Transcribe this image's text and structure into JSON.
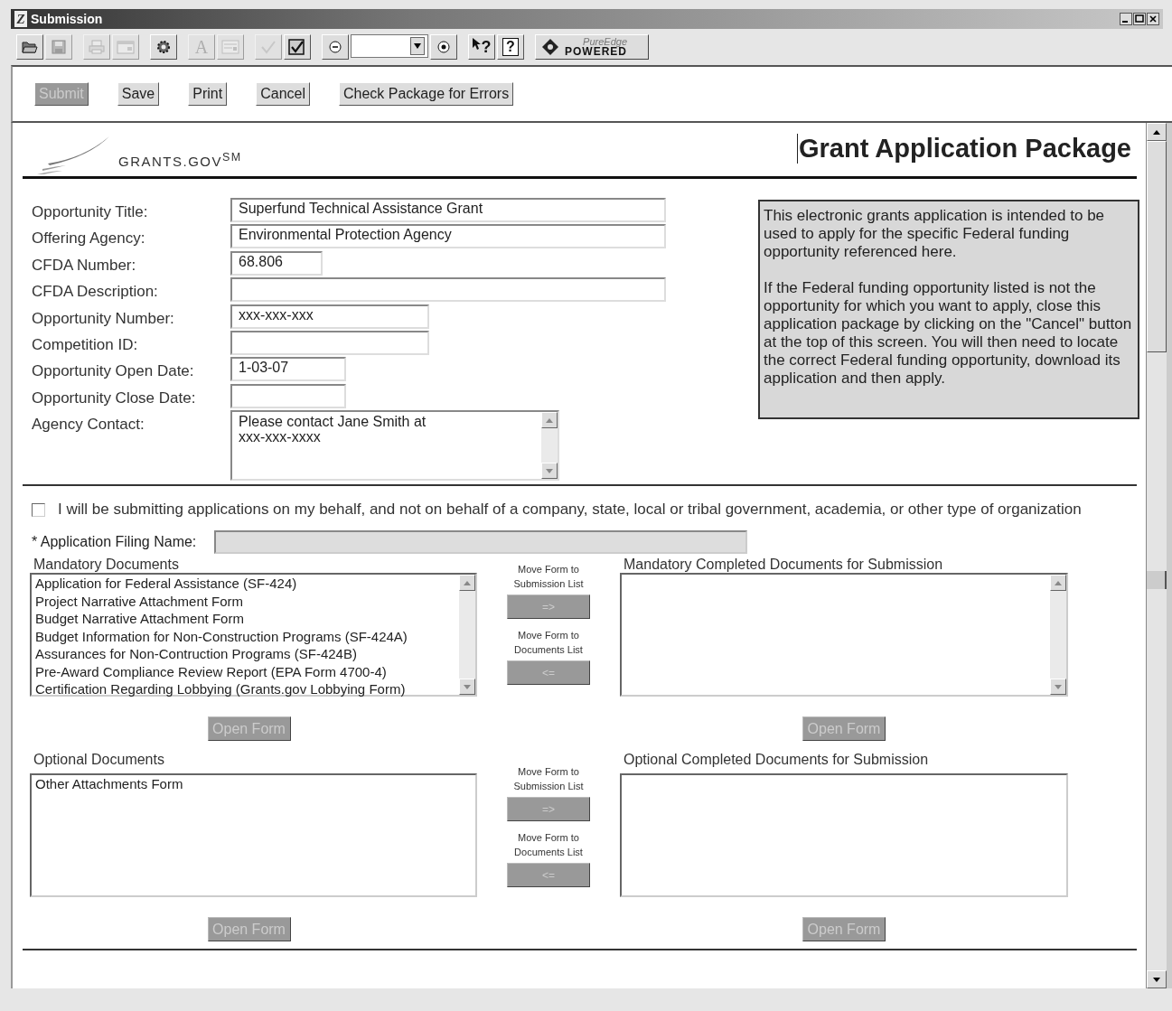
{
  "window": {
    "title": "Submission",
    "icon_glyph": "Z"
  },
  "toolbar": {
    "groups": [
      {
        "items": [
          {
            "kind": "folder",
            "disabled": false
          },
          {
            "kind": "disk",
            "disabled": true
          }
        ]
      },
      {
        "items": [
          {
            "kind": "printer",
            "disabled": true
          },
          {
            "kind": "window",
            "disabled": true
          }
        ]
      },
      {
        "items": [
          {
            "kind": "gear",
            "disabled": false
          }
        ]
      },
      {
        "items": [
          {
            "kind": "font",
            "glyph": "A",
            "disabled": true
          },
          {
            "kind": "form",
            "disabled": true
          }
        ]
      },
      {
        "items": [
          {
            "kind": "check",
            "disabled": true
          },
          {
            "kind": "checked-doc",
            "disabled": false
          }
        ]
      },
      {
        "items": [
          {
            "kind": "zoom-out",
            "disabled": false
          },
          {
            "kind": "zoom-field",
            "disabled": false
          },
          {
            "kind": "zoom-in",
            "disabled": false
          }
        ]
      },
      {
        "items": [
          {
            "kind": "pointer-help",
            "glyph": "?",
            "disabled": false
          },
          {
            "kind": "help-page",
            "glyph": "?",
            "disabled": false
          }
        ]
      }
    ],
    "badge": {
      "top": "PureEdge",
      "bottom": "POWERED"
    }
  },
  "actions": [
    {
      "label": "Submit",
      "disabled": true
    },
    {
      "label": "Save",
      "disabled": false
    },
    {
      "label": "Print",
      "disabled": false
    },
    {
      "label": "Cancel",
      "disabled": false
    },
    {
      "label": "Check Package for Errors",
      "disabled": false
    }
  ],
  "header": {
    "logo": "GRANTS.GOV$^{SM}$",
    "title": "Grant Application Package"
  },
  "fields": [
    {
      "label": "Opportunity Title:",
      "value": "Superfund Technical Assistance Grant",
      "kind": "text"
    },
    {
      "label": "Offering Agency:",
      "value": "Environmental Protection Agency",
      "kind": "text"
    },
    {
      "label": "CFDA Number:",
      "value": "68.806",
      "kind": "text"
    },
    {
      "label": "CFDA Description:",
      "kind": "text"
    },
    {
      "label": "Opportunity Number:",
      "value": "xxx-xxx-xxx",
      "kind": "text"
    },
    {
      "label": "Competition ID:",
      "kind": "text"
    },
    {
      "label": "Opportunity Open Date:",
      "value": "1-03-07",
      "kind": "text"
    },
    {
      "label": "Opportunity Close Date:",
      "kind": "text"
    },
    {
      "label": "Agency Contact:",
      "value": "Please contact Jane Smith at\nxxx-xxx-xxxx",
      "kind": "memo"
    }
  ],
  "notice": {
    "paragraphs": [
      "This electronic grants application is intended to be used to apply for the specific Federal funding opportunity referenced here.",
      "If the Federal funding opportunity listed is not the opportunity for which you want to apply, close this application package by clicking on the \"Cancel\" button at the top of this screen. You will then need to locate the correct Federal funding opportunity, download its application and then apply."
    ]
  },
  "individual": {
    "checked": false,
    "label": "I will be submitting applications on my behalf, and not on behalf of a company, state, local or tribal government, academia, or other type of organization"
  },
  "filing_name": {
    "label": "* Application Filing Name:",
    "disabled": true
  },
  "sections": [
    {
      "title": "Mandatory Documents",
      "scrollbars": true,
      "items": [
        "Application for Federal Assistance (SF-424)",
        "Project Narrative Attachment Form",
        "Budget Narrative Attachment Form",
        "Budget Information for Non-Construction Programs (SF-424A)",
        "Assurances for Non-Contruction Programs (SF-424B)",
        "Pre-Award Compliance Review Report (EPA Form 4700-4)",
        "Certification Regarding Lobbying (Grants.gov Lobbying Form)"
      ],
      "move_to_submission": {
        "caption": "Move Form to Submission List",
        "label": "=>",
        "disabled": true
      },
      "move_to_documents": {
        "caption": "Move Form to Documents List",
        "label": "<=",
        "disabled": true
      },
      "open_form": {
        "label": "Open Form",
        "disabled": true
      },
      "completed_title": "Mandatory Completed Documents for Submission",
      "completed_open_form": {
        "label": "Open Form",
        "disabled": true
      }
    },
    {
      "title": "Optional Documents",
      "scrollbars": false,
      "items": [
        "Other Attachments Form"
      ],
      "move_to_submission": {
        "caption": "Move Form to Submission List",
        "label": "=>",
        "disabled": true
      },
      "move_to_documents": {
        "caption": "Move Form to Documents List",
        "label": "<=",
        "disabled": true
      },
      "open_form": {
        "label": "Open Form",
        "disabled": true
      },
      "completed_title": "Optional Completed Documents for Submission",
      "completed_open_form": {
        "label": "Open Form",
        "disabled": true
      }
    }
  ]
}
